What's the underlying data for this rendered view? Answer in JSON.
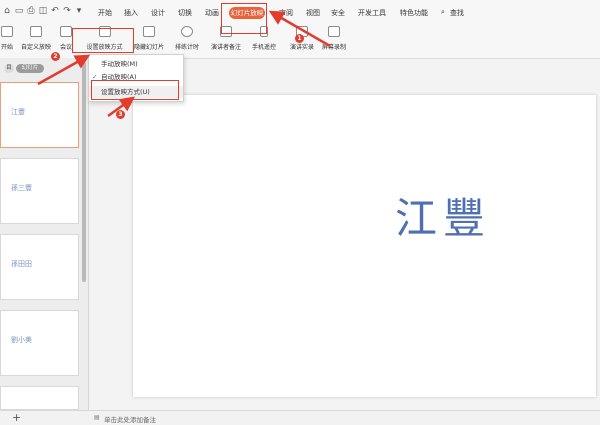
{
  "quick_access": {
    "icons": [
      "home-icon",
      "undo-icon",
      "redo-icon",
      "more-icon"
    ]
  },
  "menu": {
    "items": [
      "开始",
      "插入",
      "设计",
      "切换",
      "动画",
      "审阅",
      "视图",
      "安全",
      "开发工具",
      "特色功能"
    ],
    "active": "幻灯片放映",
    "search": "查找"
  },
  "ribbon": {
    "items": [
      "开始",
      "自定义放映",
      "会议",
      "设置放映方式",
      "隐藏幻灯片",
      "排练计时",
      "演讲者备注",
      "手机遥控",
      "演讲实录",
      "屏幕录制"
    ]
  },
  "dropdown": {
    "items": [
      {
        "label": "手动放映(M)",
        "checked": false
      },
      {
        "label": "自动放映(A)",
        "checked": true
      },
      {
        "label": "设置放映方式(U)",
        "checked": false
      }
    ]
  },
  "left_panel": {
    "tabs": [
      "目",
      "幻灯片"
    ],
    "slides": [
      "江豐",
      "孫三豐",
      "孫田田",
      "劉小美"
    ]
  },
  "slide": {
    "title": "江豐"
  },
  "status": {
    "notes_placeholder": "单击此处添加备注",
    "add_label": "+"
  },
  "annotations": {
    "badges": [
      "1",
      "2",
      "3"
    ],
    "color": "#e33b2e"
  },
  "colors": {
    "accent": "#e8623c",
    "slide_text": "#4f6fb0"
  }
}
